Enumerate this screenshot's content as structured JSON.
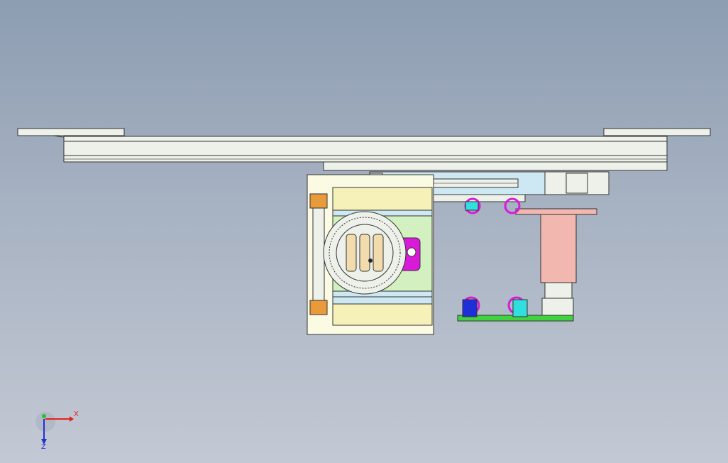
{
  "viewport": {
    "background_top": "#8d9db2",
    "background_bottom": "#c3c9d4"
  },
  "triad": {
    "x_label": "X",
    "z_label": "Z",
    "x_color": "#e8201c",
    "y_color": "#2fbf2f",
    "z_color": "#2230d8"
  },
  "part_colors": {
    "rail": "#eef0ea",
    "plate_cream": "#fbfae2",
    "block_yellow": "#f6f1b8",
    "block_green": "#d2f0c0",
    "panel_cyan": "#cde8f2",
    "bearing_tan": "#f2dcae",
    "accent_magenta": "#d91ad9",
    "slide_pink": "#f2b8b0",
    "pcb_green": "#3fd43f",
    "sensor_blue": "#1f2fd8",
    "sensor_cyan": "#2fe0df",
    "connector_orange": "#e99a3b"
  }
}
